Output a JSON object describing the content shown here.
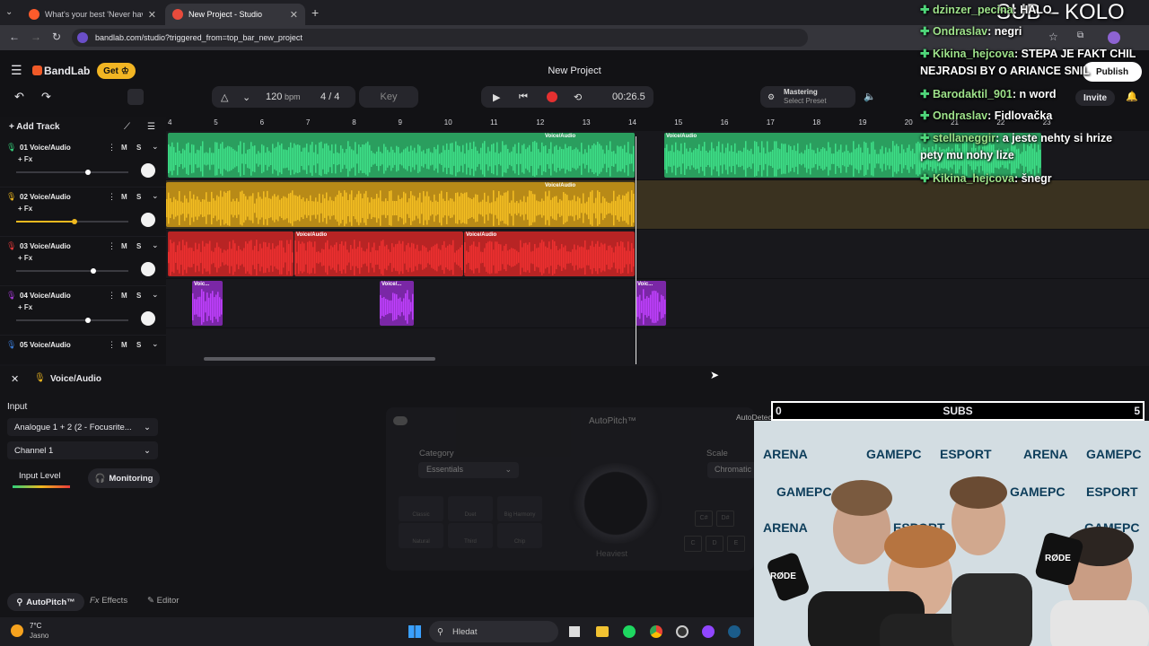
{
  "browser": {
    "tabs": [
      {
        "title": "What's your best 'Never have I"
      },
      {
        "title": "New Project - Studio"
      }
    ],
    "url": "bandlab.com/studio?triggered_from=top_bar_new_project"
  },
  "app": {
    "brand": "BandLab",
    "get_label": "Get",
    "project_title": "New Project",
    "publish_label": "Publish",
    "invite_label": "Invite",
    "mastering_label": "Mastering",
    "mastering_sub": "Select Preset"
  },
  "transport": {
    "tempo": "120",
    "tempo_unit": "bpm",
    "time_signature": "4 / 4",
    "key_label": "Key",
    "time": "00:26.5"
  },
  "add_track_label": "Add Track",
  "ruler": [
    "4",
    "5",
    "6",
    "7",
    "8",
    "9",
    "10",
    "11",
    "12",
    "13",
    "14",
    "15",
    "16",
    "17",
    "18",
    "19",
    "20",
    "21",
    "22",
    "23"
  ],
  "tracks": [
    {
      "name": "01 Voice/Audio",
      "fx": "+ Fx",
      "m": "M",
      "s": "S",
      "color": "#35d17a",
      "volume": 0.64
    },
    {
      "name": "02 Voice/Audio",
      "fx": "+ Fx",
      "m": "M",
      "s": "S",
      "color": "#f0b91f",
      "volume": 0.52
    },
    {
      "name": "03 Voice/Audio",
      "fx": "+ Fx",
      "m": "M",
      "s": "S",
      "color": "#e83a3a",
      "volume": 0.69
    },
    {
      "name": "04 Voice/Audio",
      "fx": "+ Fx",
      "m": "M",
      "s": "S",
      "color": "#a43ad4",
      "volume": 0.64
    },
    {
      "name": "05 Voice/Audio",
      "m": "M",
      "s": "S",
      "color": "#3a7bd5"
    }
  ],
  "clip_label": "Voice/Audio",
  "clip_short": "Voice/...",
  "clip_short2": "Voic...",
  "panel": {
    "title": "Voice/Audio",
    "input_label": "Input",
    "input_value": "Analogue 1 + 2 (2 - Focusrite...",
    "channel_value": "Channel 1",
    "input_level_label": "Input Level",
    "monitoring_label": "Monitoring",
    "autopitch_title": "AutoPitch™",
    "category_label": "Category",
    "category_value": "Essentials",
    "scale_label": "Scale",
    "scale_value": "Chromatic",
    "autodetect_label": "AutoDetect Key",
    "presets": [
      "Classic",
      "Duet",
      "Big Harmony",
      "Natural",
      "Third",
      "Chip"
    ],
    "knob_label": "Heaviest",
    "keys": [
      "C#",
      "D#",
      "C",
      "D",
      "E"
    ],
    "tabs": [
      "AutoPitch™",
      "Effects",
      "Editor"
    ]
  },
  "chat": [
    {
      "user": "dzinzer_pecina",
      "msg": ": HALO"
    },
    {
      "user": "Ondraslav",
      "msg": ": negri"
    },
    {
      "user": "Kikina_hejcova",
      "msg": ": STEPA JE FAKT CHIL"
    },
    {
      "user": "",
      "msg": "NEJRADSI BY O ARIANCE SNIL"
    },
    {
      "user": "Barodaktil_901",
      "msg": ": n word"
    },
    {
      "user": "Ondraslav",
      "msg": ": Fidlovačka"
    },
    {
      "user": "stellaneggir",
      "msg": ": a jeste nehty si hrize"
    },
    {
      "user": "",
      "msg": "pety mu nohy lize"
    },
    {
      "user": "Kikina_hejcova",
      "msg": ": šnegr"
    }
  ],
  "overlay": {
    "sub_title": "SUB – KOLO",
    "subs_label": "SUBS",
    "subs_min": "0",
    "subs_max": "5",
    "subs_progress": 0.0,
    "banner": [
      "GAMEPC",
      "ESPORT",
      "ARENA"
    ],
    "mic": "RØDE"
  },
  "taskbar": {
    "weather_temp": "7°C",
    "weather_desc": "Jasno",
    "search_placeholder": "Hledat"
  }
}
